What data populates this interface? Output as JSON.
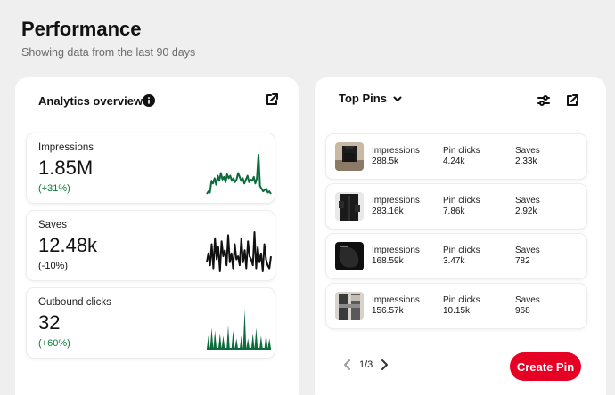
{
  "page": {
    "title": "Performance",
    "subtitle": "Showing data from the last 90 days"
  },
  "analytics": {
    "title": "Analytics overview",
    "metrics": [
      {
        "label": "Impressions",
        "value": "1.85M",
        "change": "(+31%)",
        "change_color": "#0a7d3b",
        "spark_color": "#0e6b3d",
        "spark": [
          8,
          10,
          9,
          18,
          16,
          20,
          15,
          22,
          18,
          24,
          19,
          21,
          17,
          23,
          20,
          22,
          18,
          20,
          17,
          19,
          24,
          21,
          18,
          20,
          16,
          19,
          22,
          17,
          19,
          18,
          21,
          16,
          20,
          38,
          14,
          12,
          10,
          11,
          12,
          9,
          10,
          8
        ]
      },
      {
        "label": "Saves",
        "value": "12.48k",
        "change": "(-10%)",
        "change_color": "#111111",
        "spark_color": "#111111",
        "spark": [
          14,
          20,
          12,
          26,
          10,
          30,
          16,
          24,
          8,
          28,
          18,
          22,
          12,
          32,
          14,
          20,
          10,
          26,
          16,
          18,
          12,
          30,
          14,
          22,
          10,
          28,
          18,
          16,
          12,
          34,
          10,
          24,
          14,
          20,
          8,
          26,
          16,
          12,
          10,
          18
        ]
      },
      {
        "label": "Outbound clicks",
        "value": "32",
        "change": "(+60%)",
        "change_color": "#0a7d3b",
        "spark_color": "#0e6b3d",
        "spark": [
          0,
          10,
          0,
          16,
          0,
          14,
          0,
          0,
          12,
          0,
          10,
          0,
          0,
          18,
          0,
          0,
          14,
          0,
          8,
          0,
          0,
          10,
          0,
          30,
          0,
          8,
          0,
          0,
          12,
          0,
          16,
          0,
          0,
          10,
          0,
          0,
          12,
          0,
          8,
          0
        ]
      }
    ]
  },
  "top_pins": {
    "title": "Top Pins",
    "rows": [
      {
        "impressions_label": "Impressions",
        "impressions": "288.5k",
        "clicks_label": "Pin clicks",
        "clicks": "4.24k",
        "saves_label": "Saves",
        "saves": "2.33k"
      },
      {
        "impressions_label": "Impressions",
        "impressions": "283.16k",
        "clicks_label": "Pin clicks",
        "clicks": "7.86k",
        "saves_label": "Saves",
        "saves": "2.92k"
      },
      {
        "impressions_label": "Impressions",
        "impressions": "168.59k",
        "clicks_label": "Pin clicks",
        "clicks": "3.47k",
        "saves_label": "Saves",
        "saves": "782"
      },
      {
        "impressions_label": "Impressions",
        "impressions": "156.57k",
        "clicks_label": "Pin clicks",
        "clicks": "10.15k",
        "saves_label": "Saves",
        "saves": "968"
      }
    ],
    "pager": "1/3",
    "create_label": "Create Pin"
  },
  "colors": {
    "accent": "#e60023",
    "positive": "#0a7d3b"
  },
  "icons": [
    "info-icon",
    "open-external-icon",
    "chevron-down-icon",
    "filter-sliders-icon",
    "chevron-left-icon",
    "chevron-right-icon"
  ]
}
